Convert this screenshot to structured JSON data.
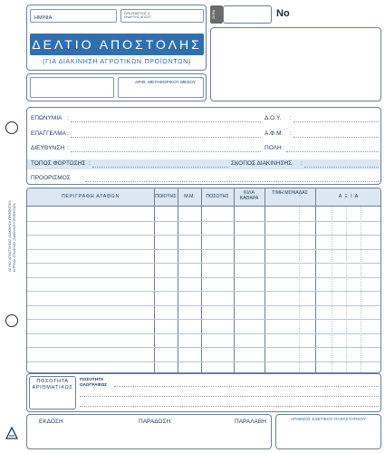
{
  "header": {
    "date_label": "ΗΜ/ΝΙΑ",
    "time_label": "ΩΡΑ ΕΝΑΡΞΗΣ & ΕΝΑΡΞΗΣ ΑΠΟΣΤ.",
    "title": "ΔΕΛΤΙΟ ΑΠΟΣΤΟΛΗΣ",
    "subtitle": "(ΓΙΑ ΔΙΑΚΙΝΗΣΗ ΑΓΡΟΤΙΚΩΝ ΠΡΟΪΟΝΤΩΝ)",
    "number_label": "No",
    "stamp_text": "ΣΕΙΡΑ",
    "vehicle_label": "ΑΡΙΘ. ΜΕΤΑΦΟΡΙΚΟΥ ΜΕΣΟΥ"
  },
  "info": {
    "name": "ΕΠΩΝΥΜΙΑ",
    "tax_office": "Δ.Ο.Υ.",
    "profession": "ΕΠΑΓΓΕΛΜΑ",
    "vat": "Α.Φ.Μ.",
    "address": "ΔΙΕΥΘΥΝΣΗ",
    "city": "ΠΟΛΗ",
    "loading_place": "ΤΟΠΟΣ ΦΟΡΤΩΣΗΣ",
    "purpose": "ΣΚΟΠΟΣ ΔΙΑΚΙΝΗΣΗΣ",
    "destination": "ΠΡΟΟΡΙΣΜΟΣ"
  },
  "table": {
    "col_description": "ΠΕΡΙΓΡΑΦΗ ΑΓΑΘΩΝ",
    "col_quality": "ΠΟΙΟΤΗΣ",
    "col_unit": "Μ.Μ.",
    "col_quantity": "ΠΟΣΟΤΗΣ",
    "col_net_kg": "ΚΙΛΑ ΚΑΘΑΡΑ",
    "col_unit_price": "ΤΙΜΗ ΜΟΝΑΔΑΣ",
    "col_value": "Α Ξ Ι Α"
  },
  "totals": {
    "quantity_numeric": "ΠΟΣΟΤΗΤΑ ΑΡΙΘΜΗΤΙΚΩΣ",
    "quantity_words": "ΠΟΣΟΤΗΤΑ ΟΛΟΓΡΑΦΩΣ"
  },
  "footer": {
    "issue": "ΕΚΔΟΣΗ",
    "delivery": "ΠΑΡΑΔΟΣΗ",
    "receipt": "ΠΑΡΑΛΑΒΗ",
    "related_doc": "ΑΡΙΘΜΟΣ ΣΧΕΤΙΚΟΥ ΠΑΡΑΣΤΑΤΙΚΟΥ"
  },
  "side": {
    "line1": "ΛΕΥΚΟ: ΑΠΟΣΤΟΛΕΑΣ (ΔΙΑΚΙΝΗΣΗ ΠΡΟΪΟΝΤΩΝ)",
    "line2": "ΚΙΤΡΙΝΟ: ΣΤΕΛΕΧΟΣ (ΔΙΑΚΙΝΗΣΗ ΠΡΟΪΟΝΤΩΝ)"
  },
  "colors": {
    "accent": "#2f6fb0",
    "ink": "#1b3a5c",
    "light": "#dbe7f3"
  }
}
